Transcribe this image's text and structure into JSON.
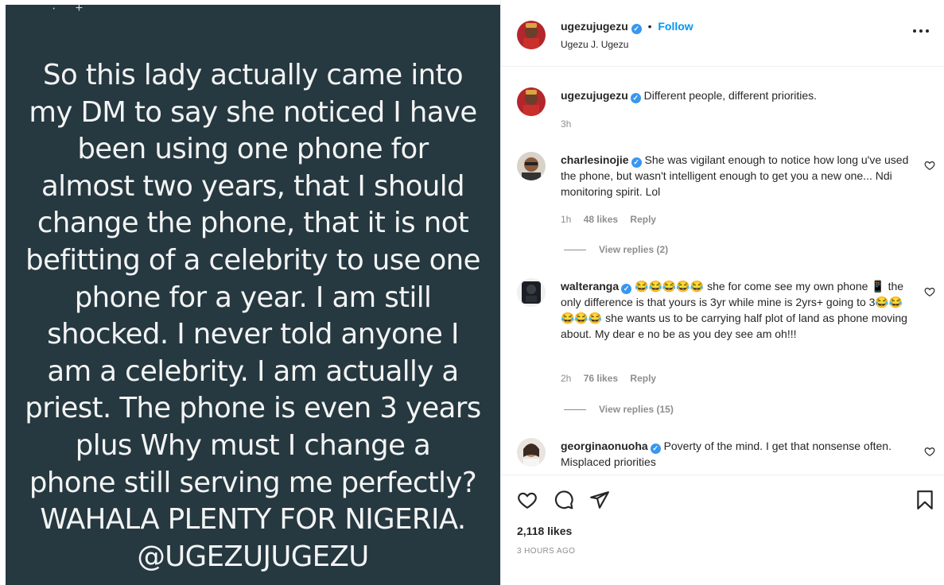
{
  "post": {
    "image_text": "So this lady actually came into\nmy DM to say she noticed I have\nbeen using one phone for\nalmost two years, that I should\nchange the phone, that it is not\nbefitting of a celebrity to use one\nphone for a year. I am still\nshocked. I never told anyone I\nam a celebrity. I am actually a\npriest. The phone is even 3 years\nplus  Why must I change a\nphone still serving me perfectly?\nWAHALA PLENTY FOR NIGERIA.\n@UGEZUJUGEZU",
    "background_color": "#263840"
  },
  "header": {
    "username": "ugezujugezu",
    "separator": "•",
    "follow_label": "Follow",
    "subtitle": "Ugezu J. Ugezu"
  },
  "caption": {
    "username": "ugezujugezu",
    "text": "Different people, different priorities.",
    "time": "3h"
  },
  "comments": [
    {
      "username": "charlesinojie",
      "text": "She was vigilant enough to notice how long u've used the phone, but wasn't intelligent enough to get you a new one... Ndi monitoring spirit. Lol",
      "time": "1h",
      "likes": "48 likes",
      "reply_label": "Reply",
      "view_replies": "View replies (2)"
    },
    {
      "username": "walteranga",
      "text": "😂😂😂😂😂 she for come see my own phone 📱 the only difference is that yours is 3yr while mine is 2yrs+ going to 3😂😂😂😂😂 she wants us to be carrying half plot of land as phone moving about. My dear e no be as you dey see am oh!!!",
      "time": "2h",
      "likes": "76 likes",
      "reply_label": "Reply",
      "view_replies": "View replies (15)"
    },
    {
      "username": "georginaonuoha",
      "text": "Poverty of the mind. I get that nonsense often. Misplaced priorities"
    }
  ],
  "footer": {
    "likes": "2,118 likes",
    "time_ago": "3 HOURS AGO"
  },
  "colors": {
    "accent": "#0095f6",
    "verified": "#3897f0",
    "muted": "#8e8e8e"
  }
}
